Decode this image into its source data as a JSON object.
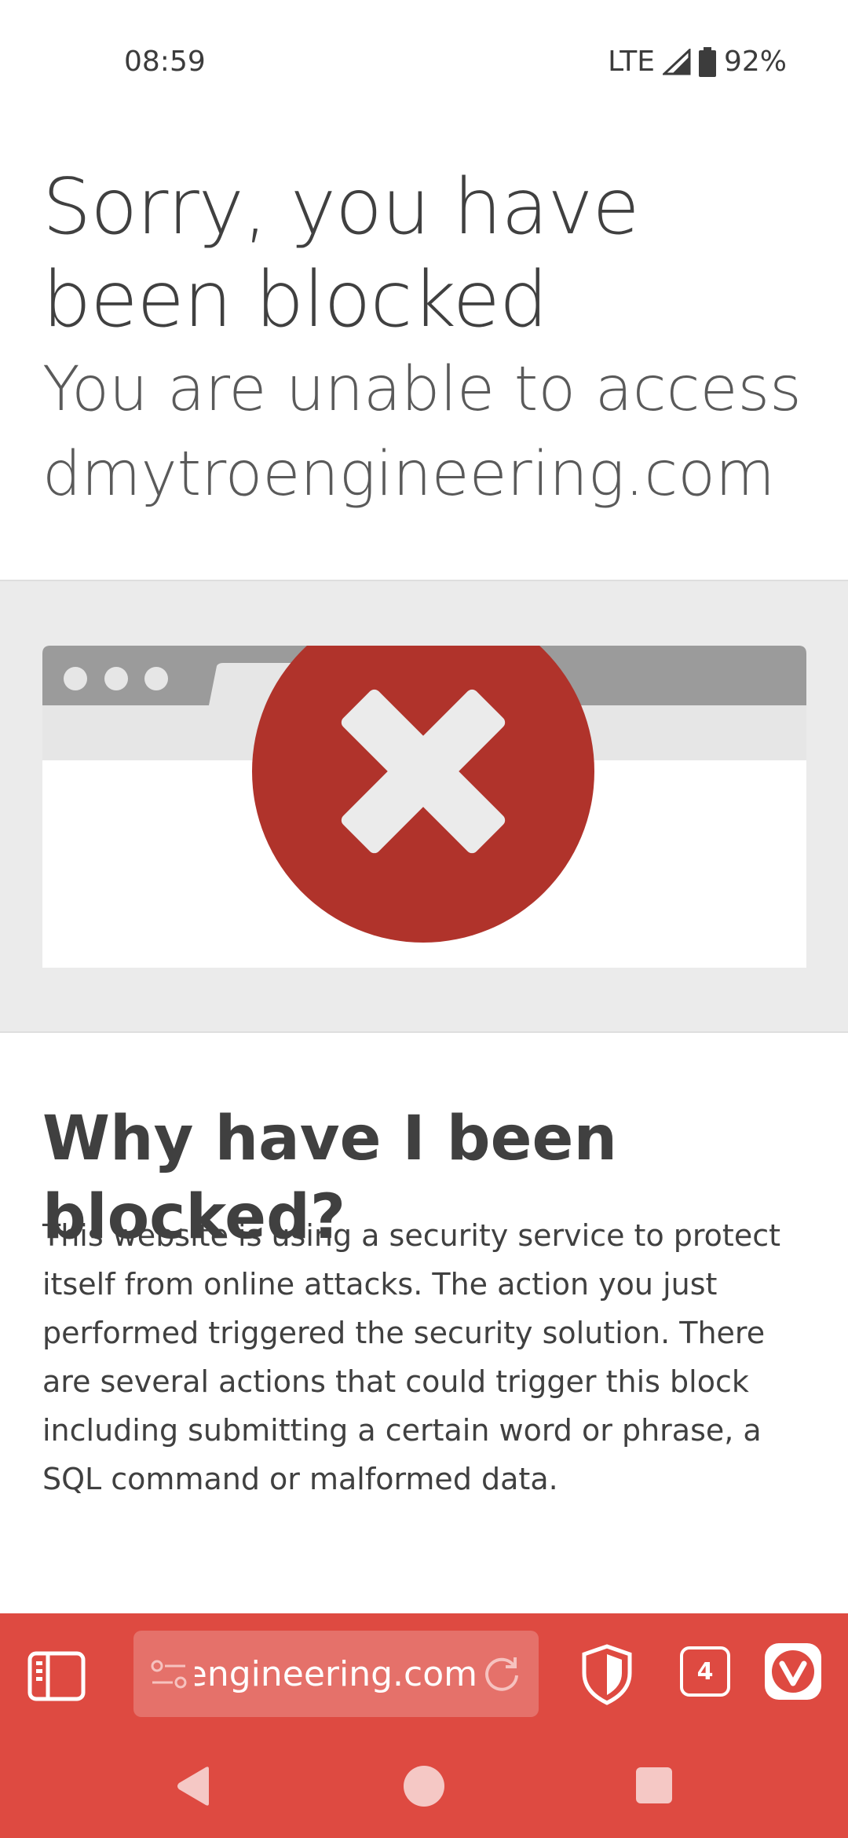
{
  "status_bar": {
    "time": "08:59",
    "network": "LTE",
    "battery": "92%",
    "icons": [
      "signal-icon",
      "battery-icon"
    ]
  },
  "page": {
    "headline": "Sorry, you have been blocked",
    "subhead": "You are unable to access dmytroengineering.com",
    "why_title": "Why have I been blocked?",
    "why_body": "This website is using a security service to protect itself from online attacks. The action you just performed triggered the security solution. There are several actions that could trigger this block including submitting a certain word or phrase, a SQL command or malformed data."
  },
  "browser_bar": {
    "url_text": "dmytroengineering.com",
    "tab_count": "4",
    "accent_color": "#de4a41",
    "icons": [
      "panel-icon",
      "site-settings-icon",
      "reload-icon",
      "shield-icon",
      "tabs-icon",
      "vivaldi-icon"
    ]
  },
  "nav_bar": {
    "icons": [
      "back-icon",
      "home-icon",
      "recents-icon"
    ]
  },
  "colors": {
    "error_red": "#b0332b",
    "band_gray": "#ebebeb",
    "text_dark": "#404040"
  }
}
